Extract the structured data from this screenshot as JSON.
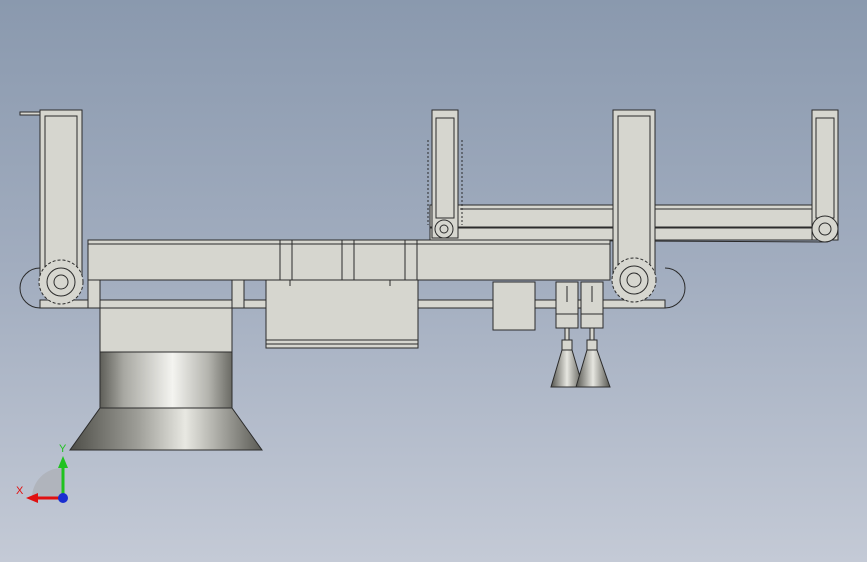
{
  "viewport": {
    "background_top": "#8a99ae",
    "background_bottom": "#c4cad6"
  },
  "model": {
    "part_fill": "#d6d6cf",
    "edge_color": "#2b2b2b",
    "metal_highlight": "#f4f4f0",
    "metal_shadow": "#5e5e58"
  },
  "triad": {
    "x_label": "X",
    "y_label": "Y",
    "x_color": "#e01010",
    "y_color": "#1fc21f",
    "z_color": "#1a2ed0"
  }
}
